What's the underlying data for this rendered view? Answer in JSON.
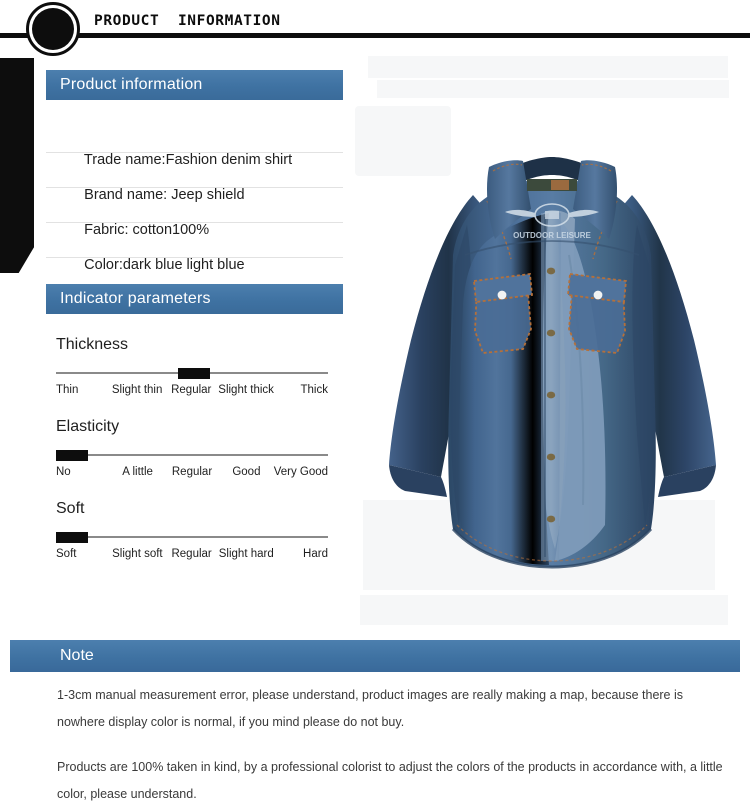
{
  "banner": {
    "title": "PRODUCT  INFORMATION",
    "circle_icon": "filled-circle-badge-icon"
  },
  "product_information": {
    "heading": "Product information",
    "rows": [
      {
        "label": "Trade name:",
        "value": "Fashion denim shirt"
      },
      {
        "label": "Brand name: ",
        "value": "Jeep shield"
      },
      {
        "label": "Fabric: ",
        "value": "cotton100%"
      },
      {
        "label": "Color:",
        "value": "dark blue light blue"
      }
    ]
  },
  "indicator_parameters": {
    "heading": "Indicator parameters",
    "params": [
      {
        "title": "Thickness",
        "labels": [
          "Thin",
          "Slight thin",
          "Regular",
          "Slight thick",
          "Thick"
        ],
        "selected_index": 2,
        "thumb_left_pct": 45
      },
      {
        "title": "Elasticity",
        "labels": [
          "No",
          "A little",
          "Regular",
          "Good",
          "Very Good"
        ],
        "selected_index": 0,
        "thumb_left_pct": 0
      },
      {
        "title": "Soft",
        "labels": [
          "Soft",
          "Slight soft",
          "Regular",
          "Slight hard",
          "Hard"
        ],
        "selected_index": 0,
        "thumb_left_pct": 0
      }
    ]
  },
  "product_photo": {
    "alt": "blue denim long-sleeve shirt with two chest pockets",
    "collar_logo_text": "OUTDOOR LEISURE"
  },
  "note": {
    "heading": "Note",
    "paragraphs": [
      "1-3cm manual measurement error, please understand, product images are really making a map, because there is nowhere display color is normal, if you mind please do not buy.",
      "Products are 100% taken in kind, by a professional colorist to adjust the colors of the products in accordance with, a little color, please understand."
    ]
  },
  "colors": {
    "accent_blue": "#3f72a2",
    "accent_blue_light": "#4c7fae",
    "black": "#0d0d0d",
    "denim_dark": "#2b4563",
    "denim_mid": "#41638c",
    "denim_light": "#6c8fb5",
    "stitch": "#b5703a",
    "ghost_panel": "#f6f7f8"
  }
}
